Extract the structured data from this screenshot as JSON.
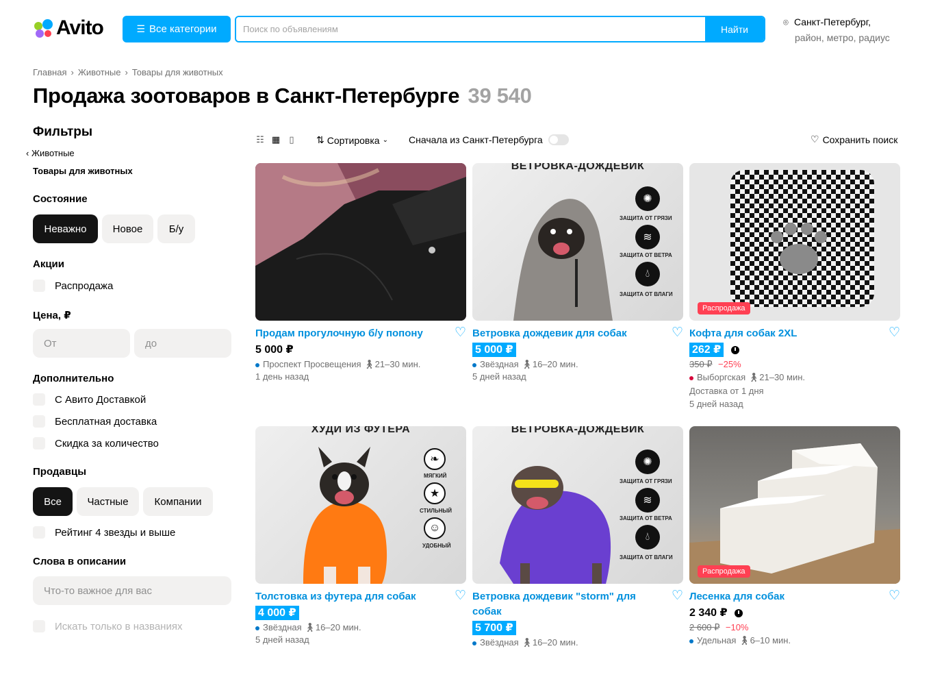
{
  "header": {
    "logo_text": "Avito",
    "categories_label": "Все категории",
    "search_placeholder": "Поиск по объявлениям",
    "search_button": "Найти",
    "location_line1": "Санкт-Петербург,",
    "location_line2": "район, метро, радиус"
  },
  "breadcrumb": [
    "Главная",
    "Животные",
    "Товары для животных"
  ],
  "page": {
    "title": "Продажа зоотоваров в Санкт-Петербурге",
    "count": "39 540"
  },
  "filters": {
    "heading": "Фильтры",
    "back_link": "Животные",
    "current_category": "Товары для животных",
    "condition": {
      "label": "Состояние",
      "options": [
        "Неважно",
        "Новое",
        "Б/у"
      ],
      "selected": "Неважно"
    },
    "promo": {
      "label": "Акции",
      "sale": "Распродажа"
    },
    "price": {
      "label": "Цена, ₽",
      "from_placeholder": "От",
      "to_placeholder": "до"
    },
    "extra": {
      "label": "Дополнительно",
      "options": [
        "С Авито Доставкой",
        "Бесплатная доставка",
        "Скидка за количество"
      ]
    },
    "sellers": {
      "label": "Продавцы",
      "options": [
        "Все",
        "Частные",
        "Компании"
      ],
      "selected": "Все",
      "rating": "Рейтинг 4 звезды и выше"
    },
    "words": {
      "label": "Слова в описании",
      "placeholder": "Что-то важное для вас",
      "titles_only": "Искать только в названиях"
    }
  },
  "toolbar": {
    "sort_label": "Сортировка",
    "spb_first": "Сначала из Санкт-Петербурга",
    "save_search": "Сохранить поиск"
  },
  "colors": {
    "accent": "#00aaff",
    "link": "#0090dd",
    "sale": "#ff4053",
    "chip_active": "#141414",
    "chip": "#f2f1f0"
  },
  "listings": [
    {
      "title": "Продам прогулочную б/у попону",
      "price": "5 000 ₽",
      "metro": "Проспект Просвещения",
      "metro_color": "#0078c9",
      "walk": "21–30 мин.",
      "date": "1 день назад"
    },
    {
      "title": "Ветровка дождевик для собак",
      "price": "5 000 ₽",
      "metro": "Звёздная",
      "metro_color": "#0078c9",
      "walk": "16–20 мин.",
      "date": "5 дней назад",
      "banner": "ВЕТРОВКА-ДОЖДЕВИК",
      "badges": [
        "ЗАЩИТА ОТ ГРЯЗИ",
        "ЗАЩИТА ОТ ВЕТРА",
        "ЗАЩИТА ОТ ВЛАГИ"
      ]
    },
    {
      "title": "Кофта для собак 2XL",
      "price": "262 ₽",
      "old_price": "350 ₽",
      "discount": "−25%",
      "metro": "Выборгская",
      "metro_color": "#d6083b",
      "walk": "21–30 мин.",
      "delivery": "Доставка от 1 дня",
      "date": "5 дней назад",
      "tag": "Распродажа"
    },
    {
      "title": "Толстовка из футера для собак",
      "price": "4 000 ₽",
      "metro": "Звёздная",
      "metro_color": "#0078c9",
      "walk": "16–20 мин.",
      "date": "5 дней назад",
      "banner": "ХУДИ ИЗ ФУТЕРА",
      "badges": [
        "МЯГКИЙ",
        "СТИЛЬНЫЙ",
        "УДОБНЫЙ"
      ]
    },
    {
      "title": "Ветровка дождевик \"storm\" для собак",
      "price": "5 700 ₽",
      "metro": "Звёздная",
      "metro_color": "#0078c9",
      "walk": "16–20 мин.",
      "banner": "ВЕТРОВКА-ДОЖДЕВИК",
      "badges": [
        "ЗАЩИТА ОТ ГРЯЗИ",
        "ЗАЩИТА ОТ ВЕТРА",
        "ЗАЩИТА ОТ ВЛАГИ"
      ]
    },
    {
      "title": "Лесенка для собак",
      "price": "2 340 ₽",
      "old_price": "2 600 ₽",
      "discount": "−10%",
      "metro": "Удельная",
      "metro_color": "#0078c9",
      "walk": "6–10 мин.",
      "tag": "Распродажа"
    }
  ]
}
